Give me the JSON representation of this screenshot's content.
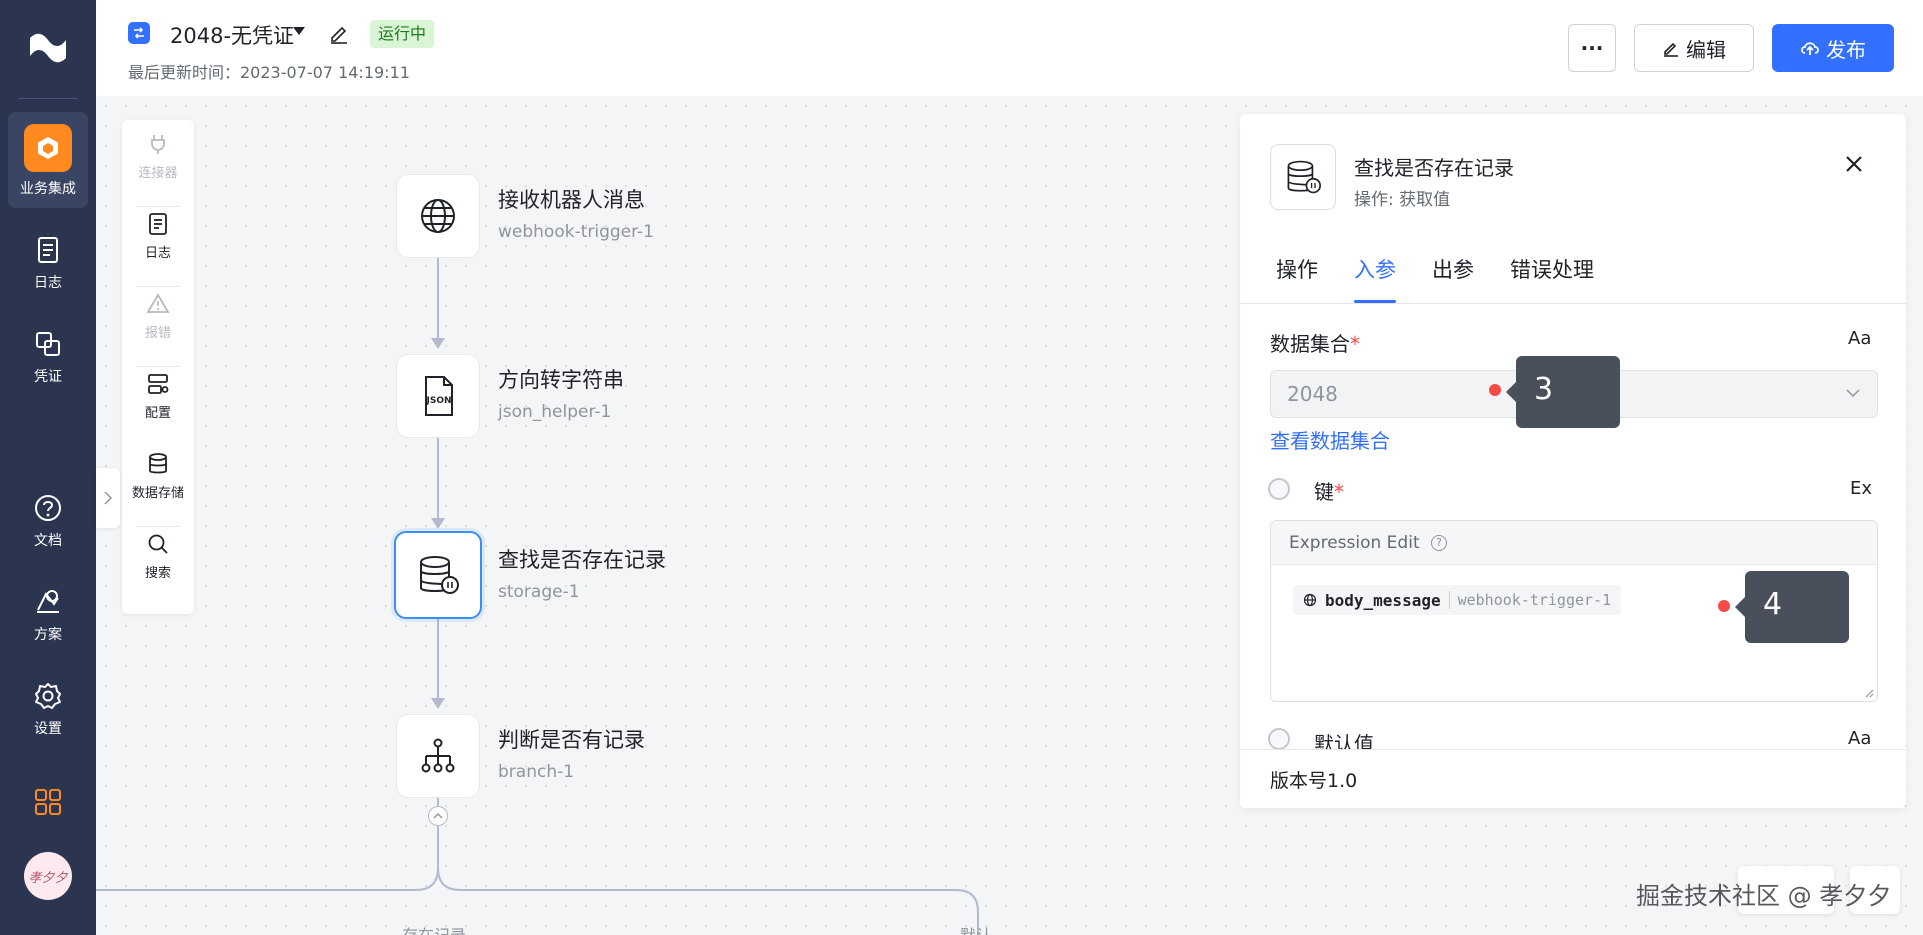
{
  "nav": {
    "items": [
      {
        "label": "业务集成",
        "icon": "business-integration-icon",
        "active": true
      },
      {
        "label": "日志",
        "icon": "log-icon"
      },
      {
        "label": "凭证",
        "icon": "credential-icon"
      },
      {
        "label": "文档",
        "icon": "help-icon"
      },
      {
        "label": "方案",
        "icon": "solution-icon"
      },
      {
        "label": "设置",
        "icon": "settings-icon"
      }
    ],
    "avatar_text": "孝夕夕"
  },
  "header": {
    "title": "2048-无凭证",
    "status": "运行中",
    "updated": "最后更新时间：2023-07-07 14:19:11",
    "more_label": "···",
    "edit_label": "编辑",
    "publish_label": "发布",
    "accent": "#3370ff"
  },
  "toolbox": {
    "items": [
      {
        "label": "连接器",
        "icon": "plug-icon",
        "disabled": true
      },
      {
        "label": "日志",
        "icon": "log-icon",
        "disabled": false
      },
      {
        "label": "报错",
        "icon": "warning-icon",
        "disabled": true
      },
      {
        "label": "配置",
        "icon": "config-icon",
        "disabled": false
      },
      {
        "label": "数据存储",
        "icon": "database-icon",
        "disabled": false
      },
      {
        "label": "搜索",
        "icon": "search-icon",
        "disabled": false
      }
    ]
  },
  "flow": {
    "nodes": [
      {
        "title": "接收机器人消息",
        "id": "webhook-trigger-1",
        "icon": "globe-icon"
      },
      {
        "title": "方向转字符串",
        "id": "json_helper-1",
        "icon": "json-file-icon"
      },
      {
        "title": "查找是否存在记录",
        "id": "storage-1",
        "icon": "database-icon",
        "selected": true
      },
      {
        "title": "判断是否有记录",
        "id": "branch-1",
        "icon": "branch-icon"
      }
    ],
    "branches": [
      "存在记录",
      "默认"
    ]
  },
  "panel": {
    "title": "查找是否存在记录",
    "subtitle": "操作: 获取值",
    "tabs": [
      "操作",
      "入参",
      "出参",
      "错误处理"
    ],
    "active_tab": "入参",
    "dataset_label": "数据集合",
    "required_mark": "*",
    "mode_text": "Aa",
    "mode_expr": "Ex",
    "dataset_value": "2048",
    "dataset_link": "查看数据集合",
    "key_label": "键",
    "expr_header": "Expression Edit",
    "help_glyph": "?",
    "token_var": "body_message",
    "token_src": "webhook-trigger-1",
    "default_label": "默认值",
    "version": "版本号1.0"
  },
  "markers": [
    "3",
    "4"
  ],
  "watermark": "掘金技术社区 @ 孝夕夕"
}
